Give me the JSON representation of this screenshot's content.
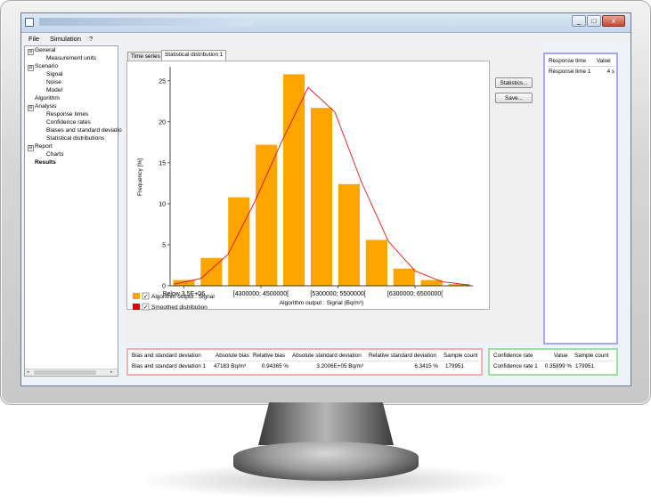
{
  "menu": {
    "file": "File",
    "simulation": "Simulation",
    "help": "?"
  },
  "window_buttons": {
    "minimize": "_",
    "maximize": "□",
    "close": "x"
  },
  "tree": {
    "general": "General",
    "measurement_units": "Measurement units",
    "scenario": "Scenario",
    "signal": "Signal",
    "noise": "Noise",
    "model": "Model",
    "algorithm": "Algorithm",
    "analysis": "Analysis",
    "response_times": "Response times",
    "confidence_rates": "Confidence rates",
    "biases": "Biases and standard deviatio",
    "statistical_distributions": "Statistical distributions",
    "report": "Report",
    "charts": "Charts",
    "results": "Results",
    "expander_minus": "⊟"
  },
  "tabs": {
    "time_series": "Time series",
    "stat_dist": "Statistical distribution 1"
  },
  "buttons": {
    "statistics": "Statistics...",
    "save": "Save..."
  },
  "chart_data": {
    "type": "bar",
    "xlabel": "Algorithm output : Signal (Bq/m³)",
    "ylabel": "Frequency [%]",
    "ylim": [
      0,
      26.5
    ],
    "yticks": [
      "0",
      "5",
      "10",
      "15",
      "20",
      "25"
    ],
    "xtick_labels": [
      "Below 3.5E+06",
      "[4300000; 4500000[",
      "[5300000; 5500000[",
      "[6300000; 6500000["
    ],
    "values": [
      0.7,
      3.4,
      10.8,
      17.2,
      25.8,
      21.7,
      12.4,
      5.6,
      2.1,
      0.7,
      0.2
    ],
    "smoothed": [
      0.2,
      0.9,
      3.8,
      10.2,
      17.5,
      24.2,
      21.2,
      12.6,
      5.4,
      1.8,
      0.5,
      0.1
    ],
    "legend": [
      {
        "label": "Algorithm output : Signal",
        "color": "#ffa500",
        "checked": true
      },
      {
        "label": "Smoothed distribution",
        "color": "#e00000",
        "checked": true
      }
    ],
    "check_mark": "✓"
  },
  "response_table": {
    "headers": [
      "Response time",
      "Value"
    ],
    "rows": [
      [
        "Response time 1",
        "4 s"
      ]
    ]
  },
  "bias_table": {
    "headers": [
      "Bias and standard deviation",
      "Absolute bias",
      "Relative bias",
      "Absolute standard deviation",
      "Relative standard deviation",
      "Sample count"
    ],
    "rows": [
      [
        "Bias and standard deviation 1",
        "47183 Bq/m³",
        "0.94365 %",
        "3.2006E+05 Bq/m³",
        "6.3415 %",
        "179951"
      ]
    ]
  },
  "confidence_table": {
    "headers": [
      "Confidence rate",
      "Value",
      "Sample count"
    ],
    "rows": [
      [
        "Confidence rate 1",
        "0.35899 %",
        "179951"
      ]
    ]
  }
}
